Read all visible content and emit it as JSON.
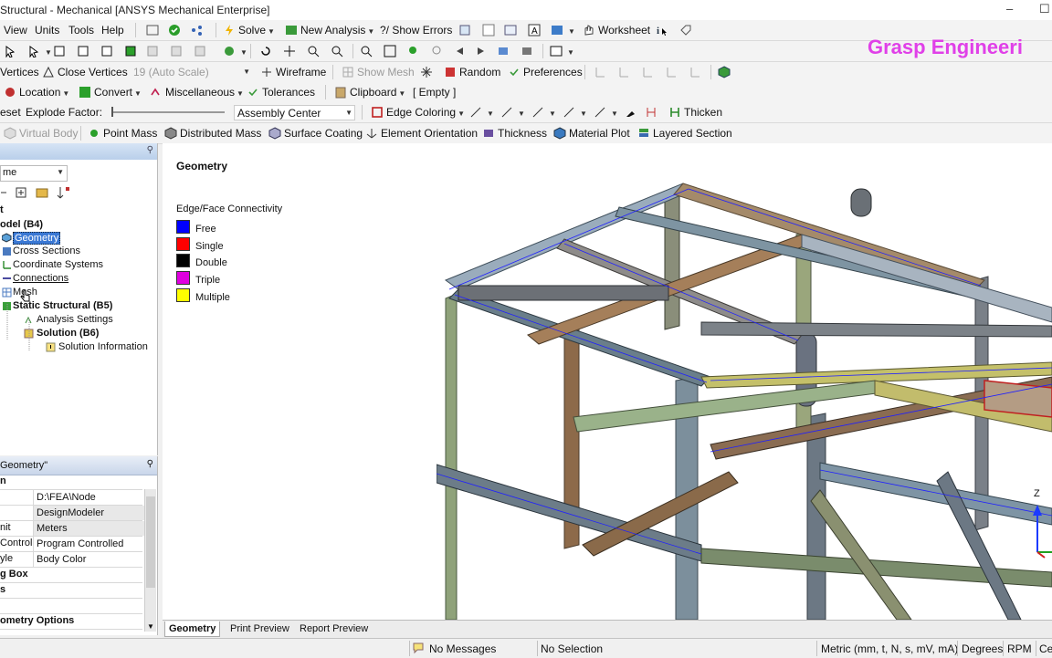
{
  "window": {
    "title": "Structural - Mechanical [ANSYS Mechanical Enterprise]",
    "min": "–",
    "max": "☐"
  },
  "brand": {
    "text": "Grasp Engineeri",
    "color": "#e040e8"
  },
  "menu": {
    "view": "View",
    "units": "Units",
    "tools": "Tools",
    "help": "Help",
    "solve": "Solve",
    "new_analysis": "New Analysis",
    "show_errors": "?/ Show Errors",
    "worksheet": "Worksheet"
  },
  "toolbar2": {},
  "toolbar3": {
    "vertices": "Vertices",
    "close_vertices": "Close Vertices",
    "scale": "19 (Auto Scale)",
    "wireframe": "Wireframe",
    "show_mesh": "Show Mesh",
    "random": "Random",
    "preferences": "Preferences"
  },
  "toolbar4": {
    "location": "Location",
    "convert": "Convert",
    "misc": "Miscellaneous",
    "tolerances": "Tolerances",
    "clipboard": "Clipboard",
    "empty": "[ Empty ]"
  },
  "toolbar5": {
    "reset": "eset",
    "explode": "Explode Factor:",
    "assembly": "Assembly Center",
    "edge_coloring": "Edge Coloring",
    "thicken": "Thicken"
  },
  "toolbar6": {
    "virtual_body": "Virtual Body",
    "point_mass": "Point Mass",
    "distributed_mass": "Distributed Mass",
    "surface_coating": "Surface Coating",
    "element_orientation": "Element Orientation",
    "thickness": "Thickness",
    "material_plot": "Material Plot",
    "layered_section": "Layered Section"
  },
  "tree": {
    "filter": "me",
    "project": "t",
    "model": "odel (B4)",
    "geometry": "Geometry",
    "cross_sections": "Cross Sections",
    "coord_systems": "Coordinate Systems",
    "connections": "Connections",
    "mesh": "Mesh",
    "static": "Static Structural (B5)",
    "analysis_settings": "Analysis Settings",
    "solution": "Solution (B6)",
    "solution_info": "Solution Information"
  },
  "details": {
    "title": "Geometry\"",
    "pin": "⚲",
    "rows": [
      {
        "k": "n",
        "v": "",
        "grp": true
      },
      {
        "k": "",
        "v": "D:\\FEA\\Node Merge\\N...",
        "g": false
      },
      {
        "k": "",
        "v": "DesignModeler",
        "g": true
      },
      {
        "k": "nit",
        "v": "Meters",
        "g": true
      },
      {
        "k": "Control",
        "v": "Program Controlled",
        "g": false
      },
      {
        "k": "yle",
        "v": "Body Color",
        "g": false
      },
      {
        "k": "g Box",
        "v": "",
        "grp": true
      },
      {
        "k": "s",
        "v": "",
        "grp": true
      },
      {
        "k": "",
        "v": "",
        "grp": true
      },
      {
        "k": "ometry Options",
        "v": "",
        "grp": true
      }
    ]
  },
  "graphics": {
    "title": "Geometry",
    "legend_title": "Edge/Face Connectivity",
    "legend": [
      {
        "label": "Free",
        "color": "#0000ff"
      },
      {
        "label": "Single",
        "color": "#ff0000"
      },
      {
        "label": "Double",
        "color": "#000000"
      },
      {
        "label": "Triple",
        "color": "#e000e0"
      },
      {
        "label": "Multiple",
        "color": "#ffff00"
      }
    ],
    "axis_z": "Z"
  },
  "tabs": {
    "geometry": "Geometry",
    "print_preview": "Print Preview",
    "report_preview": "Report Preview"
  },
  "status": {
    "messages": "No Messages",
    "selection": "No Selection",
    "units": "Metric (mm, t, N, s, mV, mA)",
    "degrees": "Degrees",
    "rpm": "RPM",
    "ce": "Ce"
  }
}
